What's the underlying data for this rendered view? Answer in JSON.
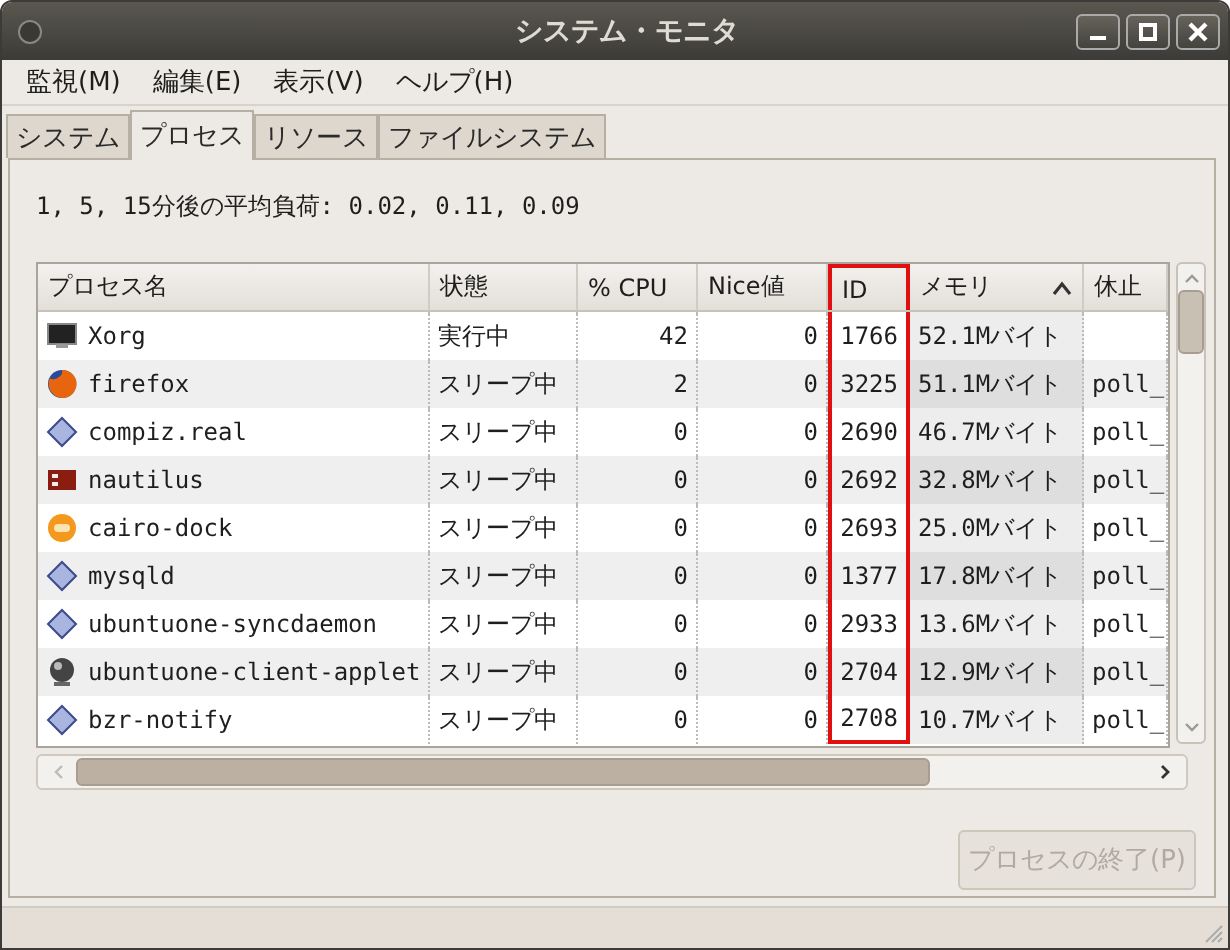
{
  "window": {
    "title": "システム・モニタ"
  },
  "menu": [
    "監視(M)",
    "編集(E)",
    "表示(V)",
    "ヘルプ(H)"
  ],
  "tabs": [
    {
      "label": "システム",
      "selected": false
    },
    {
      "label": "プロセス",
      "selected": true
    },
    {
      "label": "リソース",
      "selected": false
    },
    {
      "label": "ファイルシステム",
      "selected": false
    }
  ],
  "load_average": "1, 5, 15分後の平均負荷: 0.02, 0.11, 0.09",
  "table": {
    "columns": [
      {
        "label": "プロセス名",
        "sorted": false,
        "highlighted": false
      },
      {
        "label": "状態",
        "sorted": false,
        "highlighted": false
      },
      {
        "label": "% CPU",
        "sorted": false,
        "highlighted": false
      },
      {
        "label": "Nice値",
        "sorted": false,
        "highlighted": false
      },
      {
        "label": "ID",
        "sorted": false,
        "highlighted": true
      },
      {
        "label": "メモリ",
        "sorted": true,
        "highlighted": false
      },
      {
        "label": "休止",
        "sorted": false,
        "highlighted": false
      }
    ],
    "rows": [
      {
        "kind": "monitor",
        "cells": [
          "Xorg",
          "実行中",
          "42",
          "0",
          "1766",
          "52.1Mバイト",
          null
        ]
      },
      {
        "kind": "globe",
        "cells": [
          "firefox",
          "スリープ中",
          "2",
          "0",
          "3225",
          "51.1Mバイト",
          "poll_"
        ]
      },
      {
        "kind": "diamond",
        "cells": [
          "compiz.real",
          "スリープ中",
          "0",
          "0",
          "2690",
          "46.7Mバイト",
          "poll_"
        ]
      },
      {
        "kind": "panel",
        "cells": [
          "nautilus",
          "スリープ中",
          "0",
          "0",
          "2692",
          "32.8Mバイト",
          "poll_"
        ]
      },
      {
        "kind": "orange",
        "cells": [
          "cairo-dock",
          "スリープ中",
          "0",
          "0",
          "2693",
          "25.0Mバイト",
          "poll_"
        ]
      },
      {
        "kind": "diamond",
        "cells": [
          "mysqld",
          "スリープ中",
          "0",
          "0",
          "1377",
          "17.8Mバイト",
          "poll_"
        ]
      },
      {
        "kind": "diamond",
        "cells": [
          "ubuntuone-syncdaemon",
          "スリープ中",
          "0",
          "0",
          "2933",
          "13.6Mバイト",
          "poll_"
        ]
      },
      {
        "kind": "sphere",
        "cells": [
          "ubuntuone-client-applet",
          "スリープ中",
          "0",
          "0",
          "2704",
          "12.9Mバイト",
          "poll_"
        ]
      },
      {
        "kind": "diamond",
        "cells": [
          "bzr-notify",
          "スリープ中",
          "0",
          "0",
          "2708",
          "10.7Mバイト",
          "poll_"
        ]
      }
    ]
  },
  "end_button": {
    "label": "プロセスの終了(P)",
    "disabled": true
  }
}
